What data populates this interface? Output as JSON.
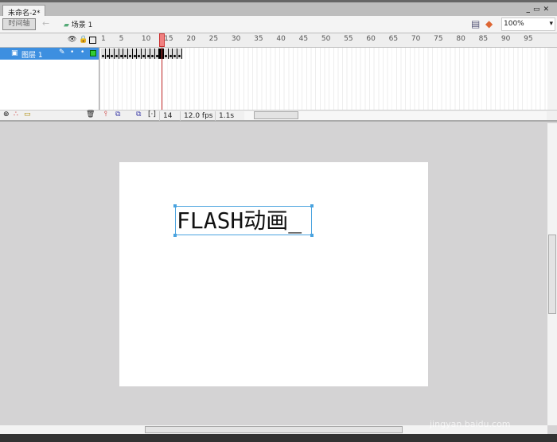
{
  "document_tab": "未命名-2*",
  "window_controls": [
    "_",
    "▭",
    "✕"
  ],
  "toolbar": {
    "timeline_label": "时间轴",
    "back_icon": "arrow-left-icon",
    "scene_label": "场景 1",
    "zoom_value": "100%"
  },
  "ruler_ticks": [
    "1",
    "5",
    "10",
    "15",
    "20",
    "25",
    "30",
    "35",
    "40",
    "45",
    "50",
    "55",
    "60",
    "65",
    "70",
    "75",
    "80",
    "85",
    "90",
    "95"
  ],
  "layer": {
    "name": "图层 1",
    "color": "#33cc33"
  },
  "timeline": {
    "current_frame": "14",
    "frame_rate": "12.0 fps",
    "elapsed": "1.1s",
    "filled_frames": 18
  },
  "stage": {
    "text": "FLASH动画_"
  },
  "watermark": "jingyan.baidu.com",
  "colors": {
    "selection": "#3d8fe0",
    "playhead": "#f08080"
  }
}
